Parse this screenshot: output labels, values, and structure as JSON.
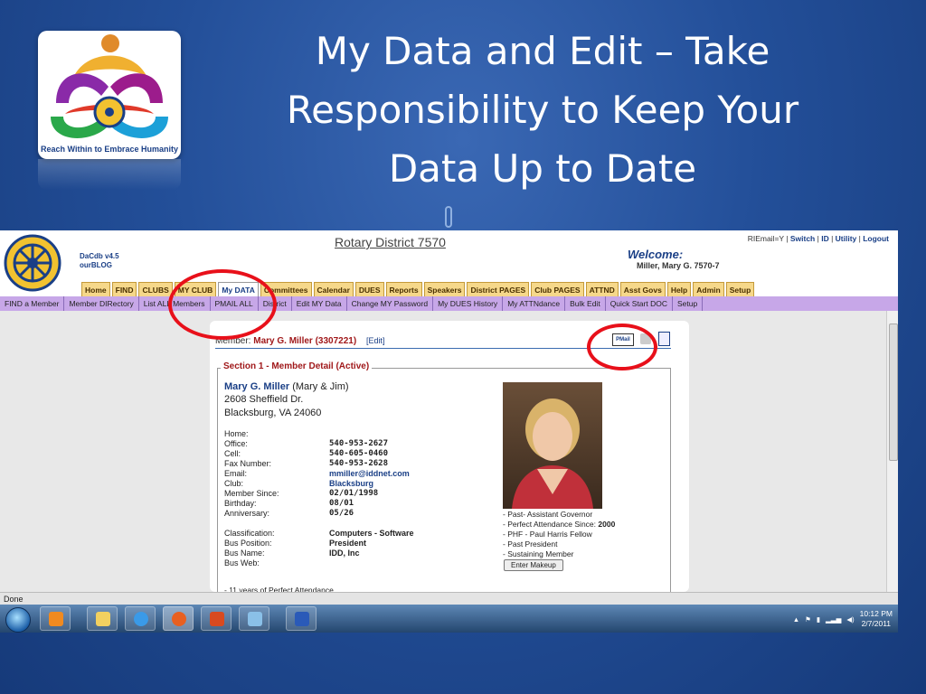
{
  "slide": {
    "title_lines": [
      "My Data and Edit – Take",
      "Responsibility to Keep Your",
      "Data Up to Date"
    ],
    "logo_caption": "Reach Within to Embrace Humanity"
  },
  "site": {
    "district_title": "Rotary District 7570",
    "dacdb_version": "DaCdb v4.5",
    "blog_link": "ourBLOG",
    "top_links": {
      "riemail": "RIEmail=Y",
      "switch": "Switch",
      "id": "ID",
      "utility": "Utility",
      "logout": "Logout"
    },
    "welcome": "Welcome:",
    "welcome_name": "Miller, Mary G. 7570-7",
    "tabs": [
      "Home",
      "FIND",
      "CLUBS",
      "MY CLUB",
      "My DATA",
      "Committees",
      "Calendar",
      "DUES",
      "Reports",
      "Speakers",
      "District PAGES",
      "Club PAGES",
      "ATTND",
      "Asst Govs",
      "Help",
      "Admin",
      "Setup"
    ],
    "active_tab": "My DATA",
    "subnav": [
      "FIND a Member",
      "Member DIRectory",
      "List ALL Members",
      "PMAIL ALL",
      "District",
      "Edit MY Data",
      "Change MY Password",
      "My DUES History",
      "My ATTNdance",
      "Bulk Edit",
      "Quick Start DOC",
      "Setup"
    ]
  },
  "member": {
    "header_label": "Member:",
    "header_name": "Mary G. Miller",
    "header_id": "(3307221)",
    "edit_link": "[Edit]",
    "pmail_icon": "PMail",
    "section_title": "Section 1 - Member Detail (Active)",
    "name": "Mary G. Miller",
    "name_suffix": "(Mary & Jim)",
    "address1": "2608 Sheffield Dr.",
    "address2": "Blacksburg, VA   24060",
    "fields": [
      {
        "label": "Home:",
        "value": ""
      },
      {
        "label": "Office:",
        "value": "540-953-2627"
      },
      {
        "label": "Cell:",
        "value": "540-605-0460"
      },
      {
        "label": "Fax Number:",
        "value": "540-953-2628"
      },
      {
        "label": "Email:",
        "value": "mmiller@iddnet.com"
      },
      {
        "label": "Club:",
        "value": "Blacksburg"
      },
      {
        "label": "Member Since:",
        "value": "02/01/1998"
      },
      {
        "label": "Birthday:",
        "value": "08/01"
      },
      {
        "label": "Anniversary:",
        "value": "05/26"
      }
    ],
    "business": [
      {
        "label": "Classification:",
        "value": "Computers - Software"
      },
      {
        "label": "Bus Position:",
        "value": "President"
      },
      {
        "label": "Bus Name:",
        "value": "IDD, Inc"
      },
      {
        "label": "Bus Web:",
        "value": ""
      }
    ],
    "awards": [
      "- Past- Assistant Governor",
      "- Perfect Attendance Since:",
      "- PHF - Paul Harris Fellow",
      "- Past President",
      "- Sustaining Member"
    ],
    "perfect_since": "2000",
    "makeup_button": "Enter Makeup",
    "attendance_note": "- 11 years of Perfect Attendance"
  },
  "browser": {
    "status": "Done"
  },
  "taskbar": {
    "time": "10:12 PM",
    "date": "2/7/2011"
  },
  "colors": {
    "slide_bg": "#234f99",
    "callout": "#e8101a",
    "subnav": "#c7a7e8",
    "tab": "#f6d88a"
  }
}
